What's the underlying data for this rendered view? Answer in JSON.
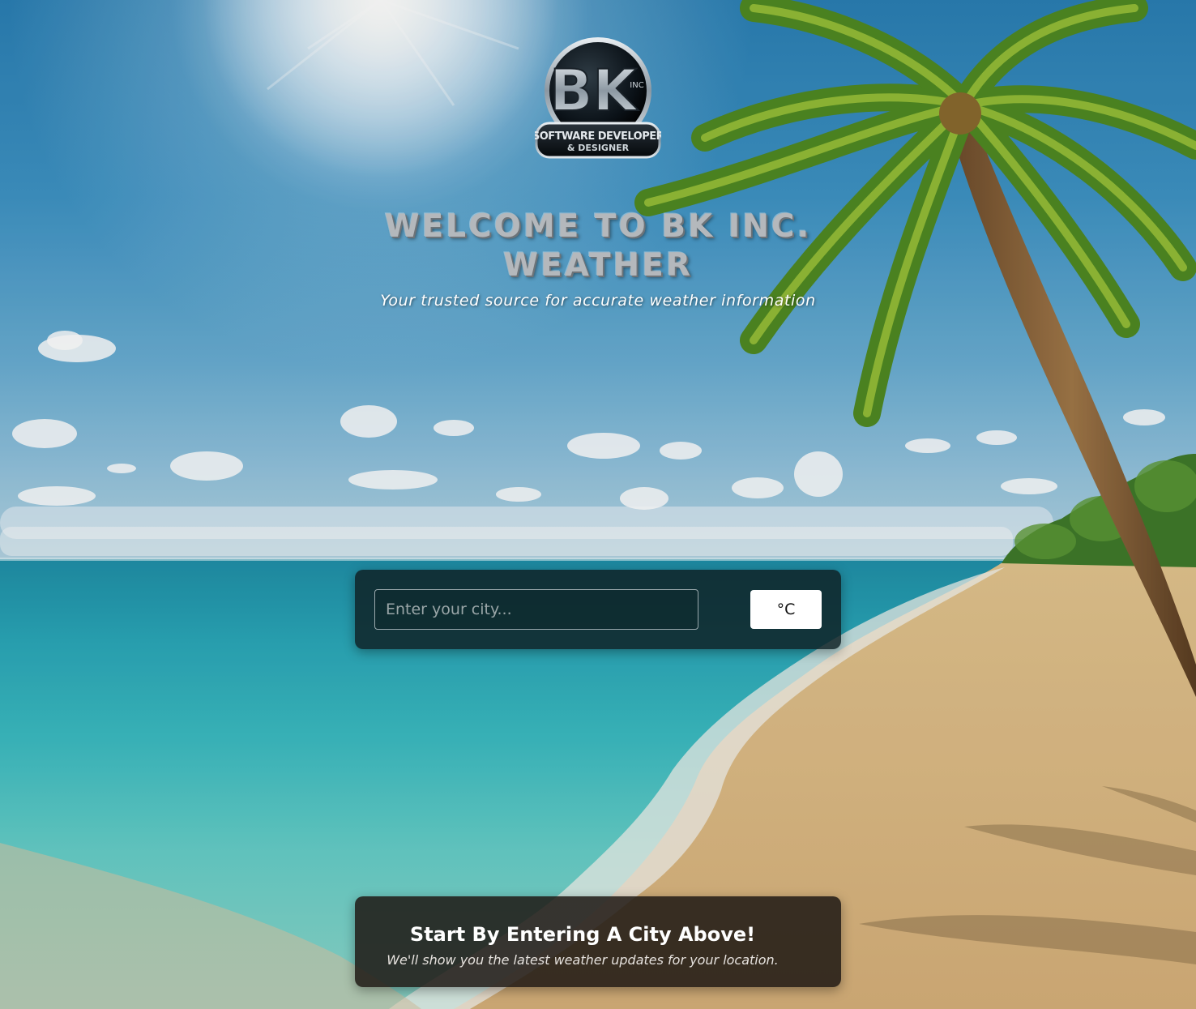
{
  "logo": {
    "monogram": "BK",
    "inc_mark": "INC",
    "tagline_line1": "SOFTWARE DEVELOPER",
    "tagline_line2": "& DESIGNER"
  },
  "header": {
    "title": "WELCOME TO BK INC. WEATHER",
    "subtitle": "Your trusted source for accurate weather information"
  },
  "search": {
    "placeholder": "Enter your city...",
    "value": "",
    "unit_label": "°C"
  },
  "info": {
    "heading": "Start By Entering A City Above!",
    "text": "We'll show you the latest weather updates for your location."
  },
  "colors": {
    "title_silver": "#b4b8bc",
    "panel_dark_teal": "#0e2024",
    "panel_dark_brown": "#1e1814",
    "button_white": "#ffffff"
  }
}
